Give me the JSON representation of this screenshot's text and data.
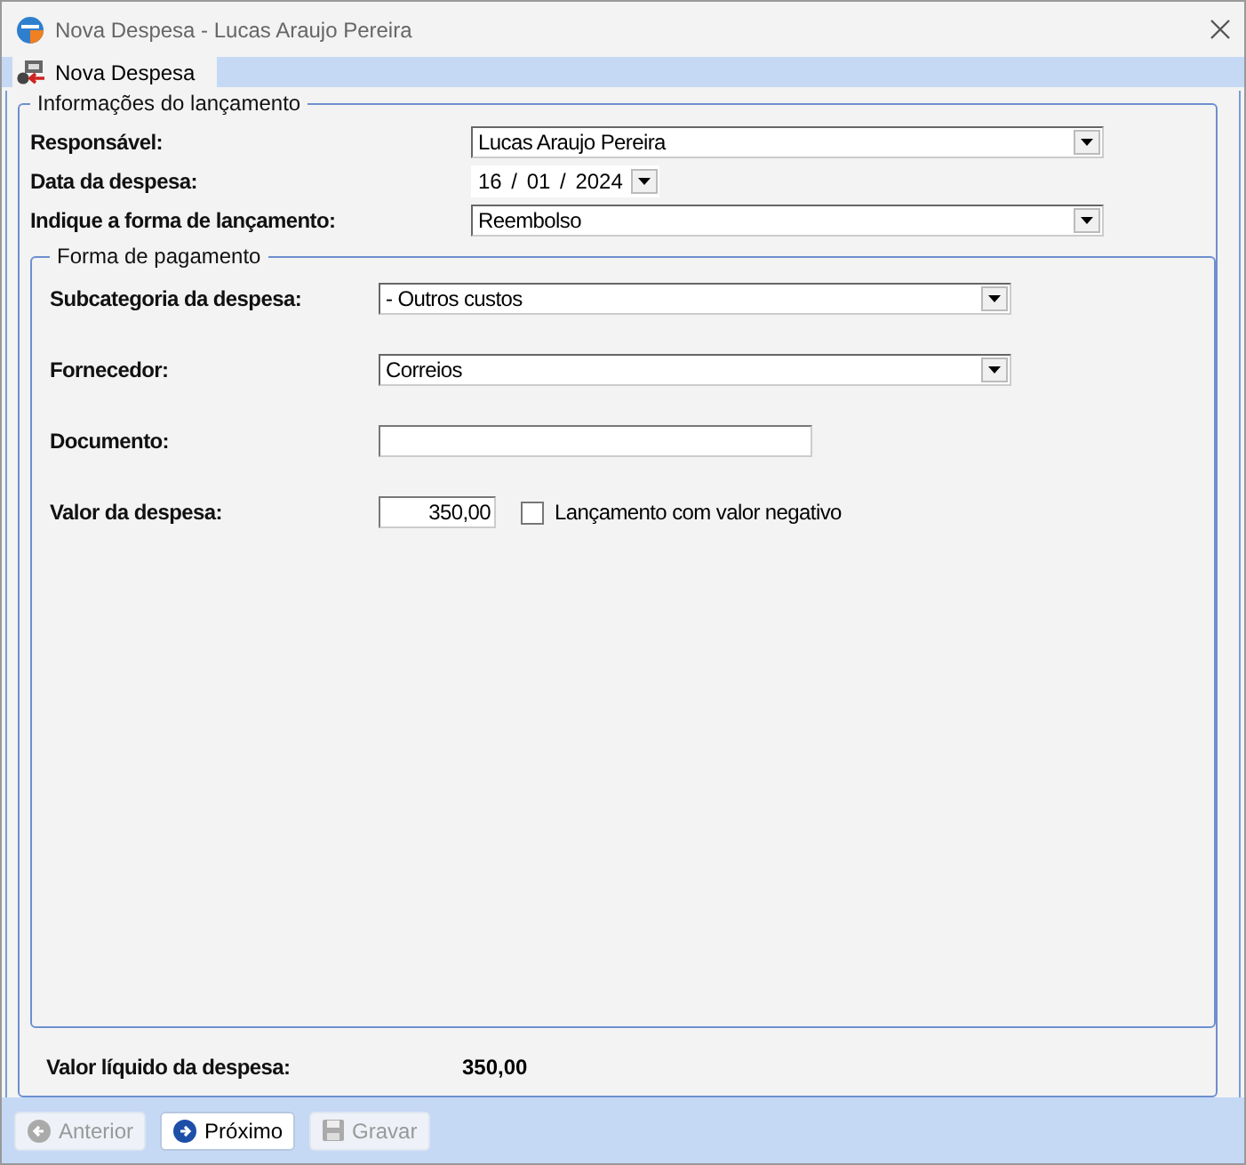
{
  "window": {
    "title": "Nova Despesa - Lucas Araujo Pereira"
  },
  "tabs": [
    {
      "label": "Nova Despesa",
      "selected": true
    }
  ],
  "launch_info": {
    "legend": "Informações do lançamento",
    "fields": [
      {
        "kind": "select",
        "label": "Responsável:",
        "value": "Lucas Araujo Pereira"
      },
      {
        "kind": "date",
        "label": "Data da despesa:",
        "value": "16 / 01 / 2024"
      },
      {
        "kind": "select",
        "label": "Indique a forma de lançamento:",
        "value": "Reembolso"
      }
    ]
  },
  "payment": {
    "legend": "Forma de pagamento",
    "fields": [
      {
        "kind": "select",
        "label": "Subcategoria da despesa:",
        "value": "- Outros custos"
      },
      {
        "kind": "select",
        "label": "Fornecedor:",
        "value": "Correios"
      },
      {
        "kind": "text",
        "label": "Documento:"
      },
      {
        "kind": "amount",
        "label": "Valor da despesa:",
        "value": "350,00",
        "checkbox_label": "Lançamento com valor negativo",
        "checked": false
      }
    ]
  },
  "net_value": {
    "label": "Valor líquido da despesa:",
    "value": "350,00"
  },
  "buttons": [
    {
      "label": "Anterior",
      "kind": "back",
      "disabled": true
    },
    {
      "label": "Próximo",
      "kind": "next",
      "disabled": false
    },
    {
      "label": "Gravar",
      "kind": "save",
      "disabled": true
    }
  ]
}
